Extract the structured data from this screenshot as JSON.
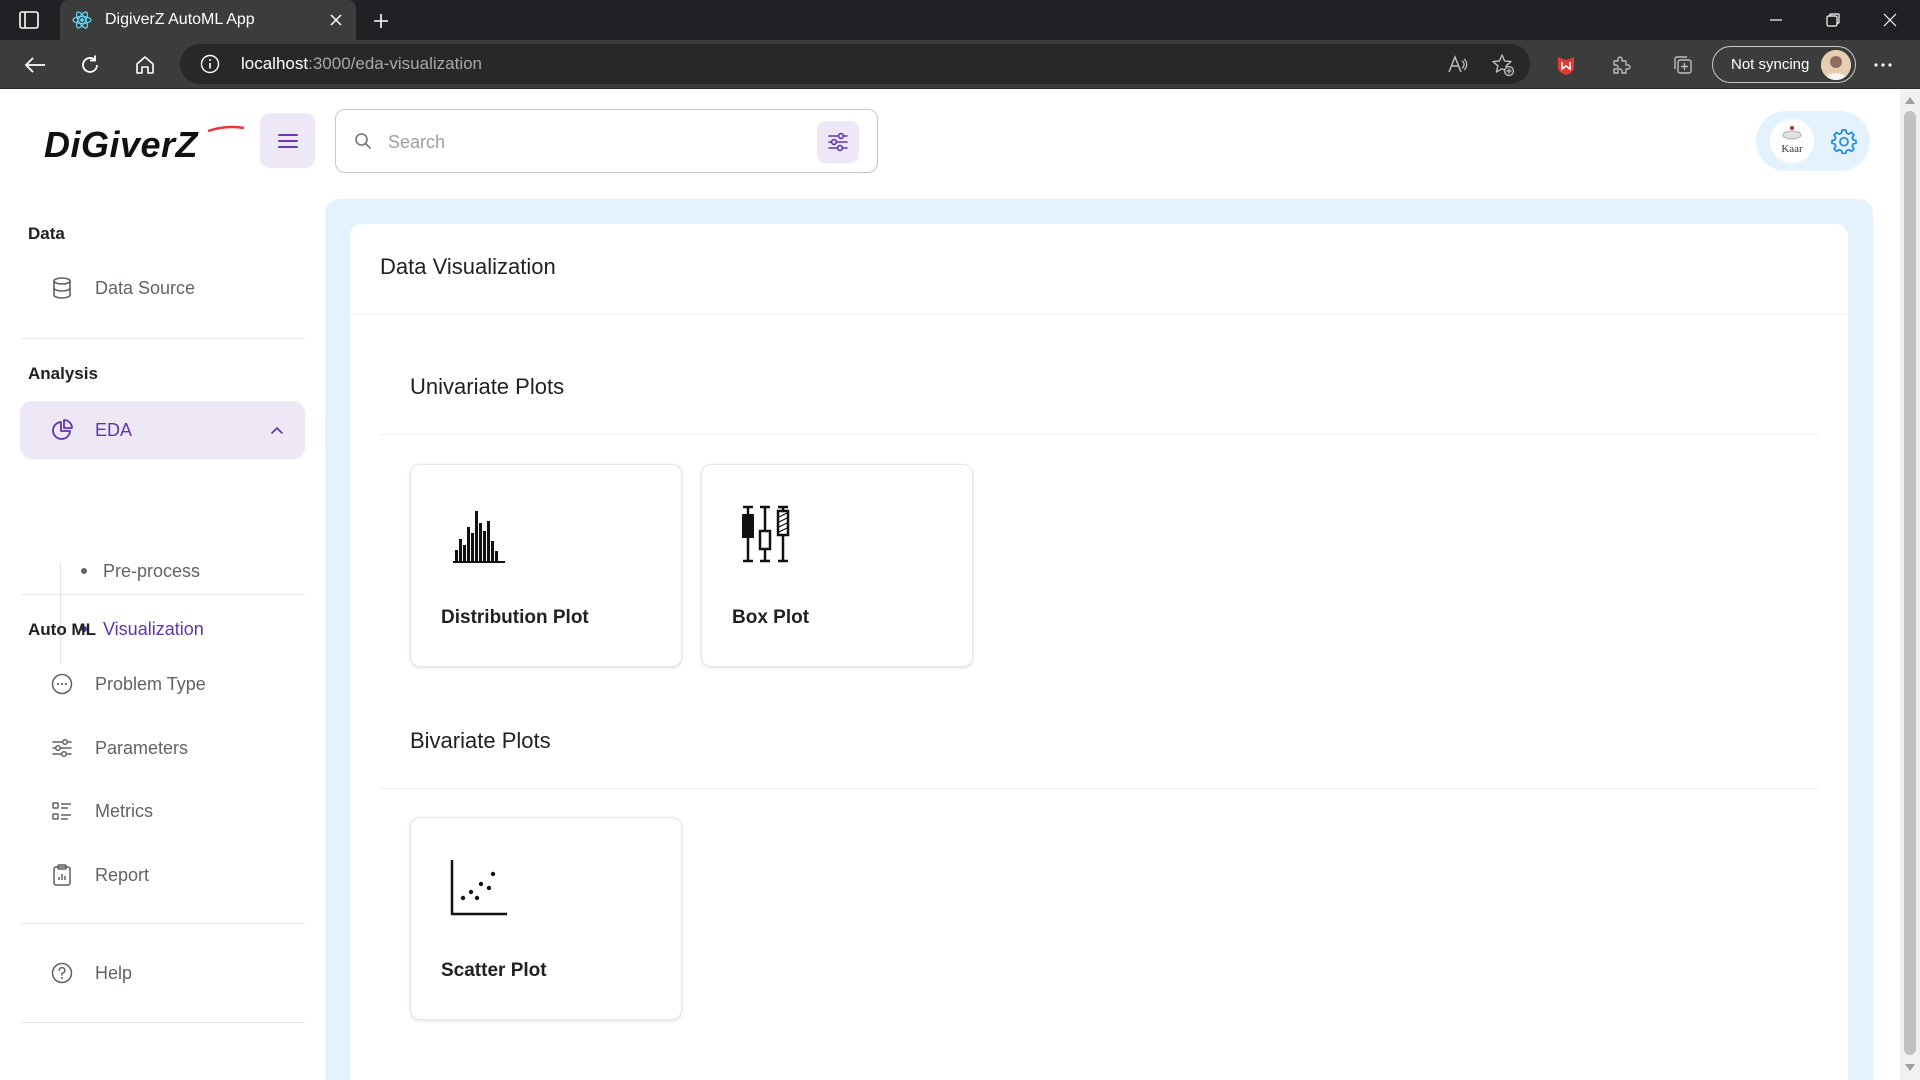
{
  "browser": {
    "tab_title": "DigiverZ AutoML App",
    "url_host": "localhost",
    "url_path": ":3000/eda-visualization",
    "sync_label": "Not syncing"
  },
  "header": {
    "logo_text": "DiGiverZ",
    "search_placeholder": "Search",
    "avatar_text": "Kaar"
  },
  "sidebar": {
    "sections": [
      {
        "title": "Data"
      },
      {
        "title": "Analysis"
      },
      {
        "title": "Auto ML"
      }
    ],
    "items": {
      "data_source": "Data Source",
      "eda": "EDA",
      "pre_process": "Pre-process",
      "visualization": "Visualization",
      "problem_type": "Problem Type",
      "parameters": "Parameters",
      "metrics": "Metrics",
      "report": "Report",
      "help": "Help"
    }
  },
  "main": {
    "title": "Data Visualization",
    "groups": [
      {
        "title": "Univariate Plots",
        "cards": [
          "Distribution Plot",
          "Box Plot"
        ]
      },
      {
        "title": "Bivariate Plots",
        "cards": [
          "Scatter Plot"
        ]
      }
    ]
  },
  "colors": {
    "accent": "#5e35b1",
    "accent_light": "#ede7f6",
    "main_bg": "#e3f2fd",
    "settings_blue": "#1e88e5"
  }
}
